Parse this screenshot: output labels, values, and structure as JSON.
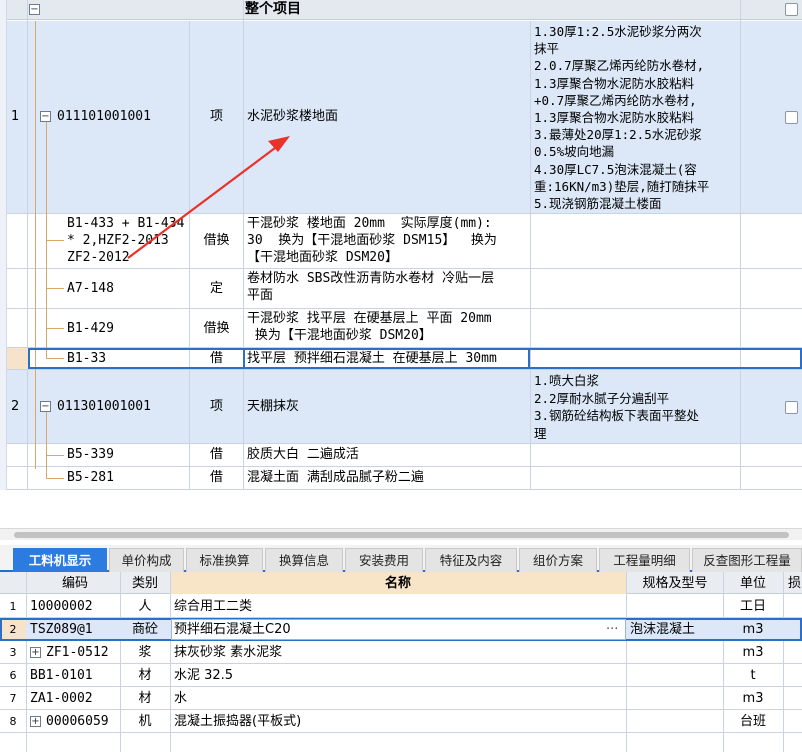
{
  "upper_grid": {
    "header": {
      "title": "整个项目"
    },
    "rows": [
      {
        "index": "1",
        "code": "011101001001",
        "type": "项",
        "name": "水泥砂浆楼地面",
        "features": "1.30厚1:2.5水泥砂浆分两次\n抹平\n2.0.7厚聚乙烯丙纶防水卷材,\n1.3厚聚合物水泥防水胶粘料\n+0.7厚聚乙烯丙纶防水卷材,\n1.3厚聚合物水泥防水胶粘料\n3.最薄处20厚1:2.5水泥砂浆\n0.5%坡向地漏\n4.30厚LC7.5泡沫混凝土(容\n重:16KN/m3)垫层,随打随抹平\n5.现浇钢筋混凝土楼面"
      },
      {
        "code": "B1-433 + B1-434\n* 2,HZF2-2013\nZF2-2012",
        "type": "借换",
        "name": "干混砂浆 楼地面 20mm  实际厚度(mm):\n30  换为【干混地面砂浆 DSM15】  换为\n【干混地面砂浆 DSM20】"
      },
      {
        "code": "A7-148",
        "type": "定",
        "name": "卷材防水 SBS改性沥青防水卷材 冷贴一层\n平面"
      },
      {
        "code": "B1-429",
        "type": "借换",
        "name": "干混砂浆 找平层 在硬基层上 平面 20mm\n 换为【干混地面砂浆 DSM20】"
      },
      {
        "code": "B1-33",
        "type": "借",
        "name": "找平层 预拌细石混凝土 在硬基层上 30mm"
      },
      {
        "index": "2",
        "code": "011301001001",
        "type": "项",
        "name": "天棚抹灰",
        "features": "1.喷大白浆\n2.2厚耐水腻子分遍刮平\n3.钢筋砼结构板下表面平整处\n理"
      },
      {
        "code": "B5-339",
        "type": "借",
        "name": "胶质大白 二遍成活"
      },
      {
        "code": "B5-281",
        "type": "借",
        "name": "混凝土面 满刮成品腻子粉二遍"
      }
    ]
  },
  "tabs": [
    "工料机显示",
    "单价构成",
    "标准换算",
    "换算信息",
    "安装费用",
    "特征及内容",
    "组价方案",
    "工程量明细",
    "反查图形工程量"
  ],
  "lower_table": {
    "columns": {
      "code": "编码",
      "category": "类别",
      "name": "名称",
      "spec": "规格及型号",
      "unit": "单位",
      "extra": "损"
    },
    "rows": [
      {
        "index": "1",
        "code": "10000002",
        "category": "人",
        "name": "综合用工二类",
        "spec": "",
        "unit": "工日"
      },
      {
        "index": "2",
        "code": "TSZ089@1",
        "category": "商砼",
        "name": "预拌细石混凝土C20",
        "spec": "泡沫混凝土",
        "unit": "m3"
      },
      {
        "index": "3",
        "code": "ZF1-0512",
        "category": "浆",
        "name": "抹灰砂浆 素水泥浆",
        "spec": "",
        "unit": "m3"
      },
      {
        "index": "6",
        "code": "BB1-0101",
        "category": "材",
        "name": "水泥 32.5",
        "spec": "",
        "unit": "t"
      },
      {
        "index": "7",
        "code": "ZA1-0002",
        "category": "材",
        "name": "水",
        "spec": "",
        "unit": "m3"
      },
      {
        "index": "8",
        "code": "00006059",
        "category": "机",
        "name": "混凝土振捣器(平板式)",
        "spec": "",
        "unit": "台班"
      }
    ],
    "ellipsis": "···",
    "plus_symbol": "+"
  },
  "symbols": {
    "collapse": "−"
  },
  "colors": {
    "accent": "#2c7be0",
    "row_highlight": "#dce8f8",
    "arrow": "#e8322a"
  }
}
